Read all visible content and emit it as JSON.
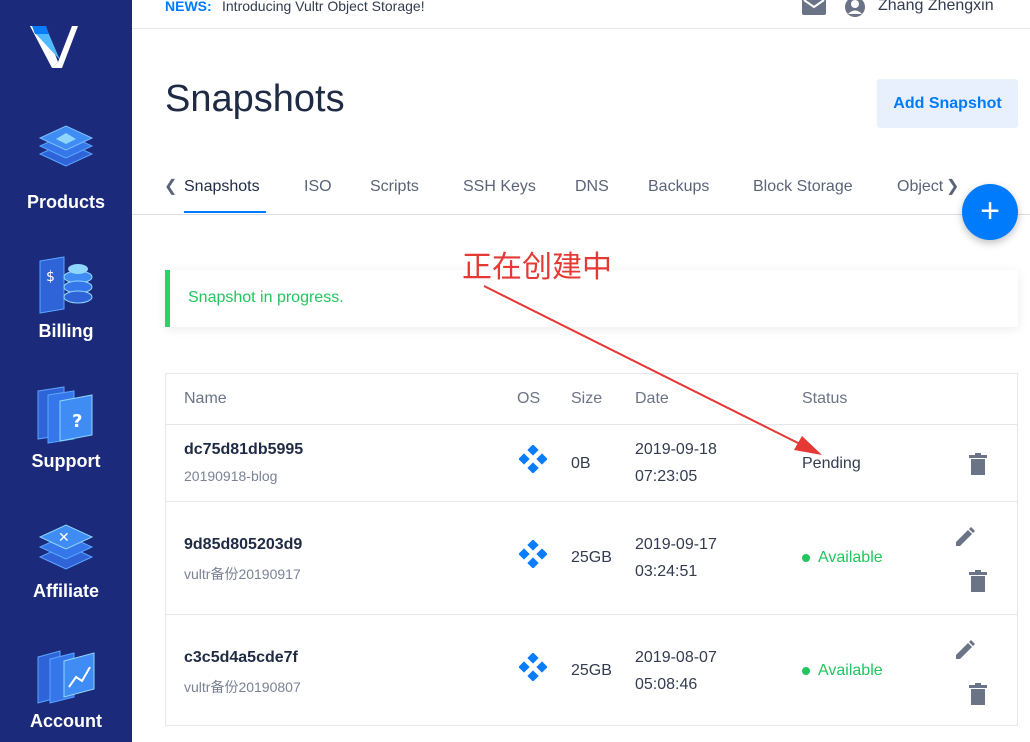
{
  "sidebar": {
    "items": [
      {
        "label": "Products",
        "icon": "stack-layers-icon"
      },
      {
        "label": "Billing",
        "icon": "billing-coins-icon"
      },
      {
        "label": "Support",
        "icon": "support-question-icon"
      },
      {
        "label": "Affiliate",
        "icon": "affiliate-layers-icon"
      },
      {
        "label": "Account",
        "icon": "account-chart-icon"
      }
    ]
  },
  "topbar": {
    "news_label": "NEWS:",
    "news_text": "Introducing Vultr Object Storage!",
    "user_name": "Zhang Zhengxin"
  },
  "page": {
    "title": "Snapshots",
    "add_button": "Add Snapshot"
  },
  "tabs": [
    "Snapshots",
    "ISO",
    "Scripts",
    "SSH Keys",
    "DNS",
    "Backups",
    "Block Storage",
    "Object"
  ],
  "alert": {
    "message": "Snapshot in progress."
  },
  "annotation": {
    "text": "正在创建中",
    "color": "#e53935"
  },
  "table": {
    "headers": [
      "Name",
      "OS",
      "Size",
      "Date",
      "Status"
    ],
    "rows": [
      {
        "name": "dc75d81db5995",
        "label": "20190918-blog",
        "size": "0B",
        "date": "2019-09-18",
        "time": "07:23:05",
        "status": "Pending"
      },
      {
        "name": "9d85d805203d9",
        "label": "vultr备份20190917",
        "size": "25GB",
        "date": "2019-09-17",
        "time": "03:24:51",
        "status": "Available"
      },
      {
        "name": "c3c5d4a5cde7f",
        "label": "vultr备份20190807",
        "size": "25GB",
        "date": "2019-08-07",
        "time": "05:08:46",
        "status": "Available"
      }
    ]
  },
  "colors": {
    "sidebar": "#1b2a7a",
    "accent": "#007bfc",
    "success": "#22c55e"
  }
}
